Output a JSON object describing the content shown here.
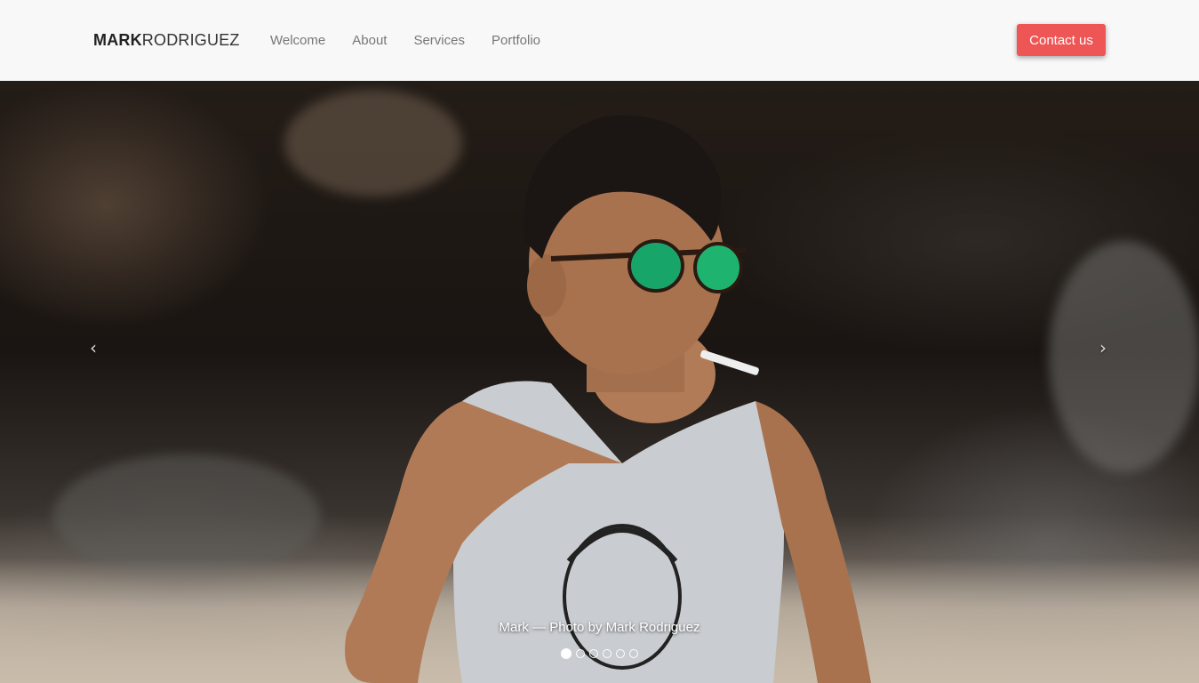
{
  "brand": {
    "bold": "MARK",
    "light": "RODRIGUEZ"
  },
  "nav": {
    "items": [
      "Welcome",
      "About",
      "Services",
      "Portfolio"
    ],
    "contact_label": "Contact us"
  },
  "carousel": {
    "caption": "Mark — Photo by Mark Rodriguez",
    "prev_glyph": "‹",
    "next_glyph": "›",
    "slide_count": 6,
    "active_index": 0
  },
  "colors": {
    "accent": "#ee5555",
    "navbar_bg": "#f8f8f8",
    "nav_text": "#777777"
  },
  "icons": {
    "prev": "chevron-left-icon",
    "next": "chevron-right-icon"
  }
}
